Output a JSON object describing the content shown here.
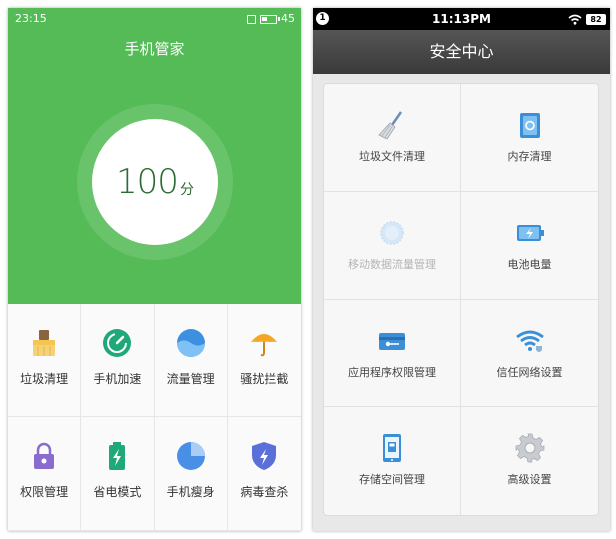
{
  "left_phone": {
    "status_bar": {
      "time": "23:15",
      "battery": "45",
      "battery_level": 0.45
    },
    "title": "手机管家",
    "score": {
      "value": "100",
      "unit": "分"
    },
    "tools": [
      {
        "label": "垃圾清理",
        "icon": "broom-icon"
      },
      {
        "label": "手机加速",
        "icon": "speedometer-icon"
      },
      {
        "label": "流量管理",
        "icon": "water-drop-icon"
      },
      {
        "label": "骚扰拦截",
        "icon": "umbrella-icon"
      },
      {
        "label": "权限管理",
        "icon": "lock-icon"
      },
      {
        "label": "省电模式",
        "icon": "battery-icon"
      },
      {
        "label": "手机瘦身",
        "icon": "pie-chart-icon"
      },
      {
        "label": "病毒查杀",
        "icon": "shield-icon"
      }
    ],
    "colors": {
      "brand": "#54bb57",
      "score_text": "#2c6b33"
    }
  },
  "right_phone": {
    "status_bar": {
      "notification_count": "1",
      "time": "11:13PM",
      "battery": "82"
    },
    "header": {
      "title": "安全中心"
    },
    "items": [
      {
        "label": "垃圾文件清理",
        "icon": "broom-icon",
        "enabled": true
      },
      {
        "label": "内存清理",
        "icon": "memory-chip-icon",
        "enabled": true
      },
      {
        "label": "移动数据流量管理",
        "icon": "data-usage-icon",
        "enabled": false
      },
      {
        "label": "电池电量",
        "icon": "battery-icon",
        "enabled": true
      },
      {
        "label": "应用程序权限管理",
        "icon": "key-card-icon",
        "enabled": true
      },
      {
        "label": "信任网络设置",
        "icon": "wifi-shield-icon",
        "enabled": true
      },
      {
        "label": "存储空间管理",
        "icon": "storage-icon",
        "enabled": true
      },
      {
        "label": "高级设置",
        "icon": "gear-icon",
        "enabled": true
      }
    ]
  }
}
